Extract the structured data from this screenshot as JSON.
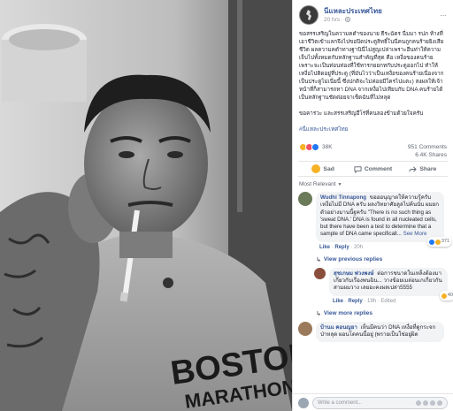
{
  "post": {
    "page_name": "นี่แหละประเทศไทย",
    "time": "20 hrs ·",
    "body_1": "ขอสรรเสริญในความคดำของนาย ธีระฉัตร นี่มมา รปภ ห้างที่เอาชีวิตเข้าแลกจึงไปขอปิดประตูสิทธิ์ในนี่คนถูกคนร้ายยิงเสียชีวิต ผลความคดำทางฐานินี่ไม่สูญเปล่าเพราะฮีนท่าให้ความเจ็บไปทั้งหมดกับหลักฐานสำคัญที่สุด คือ เหงื่อของคนร้าย เพราะจะเป็นท่อนท่องที่ใช้ทารกยยกทกับประตูออกไป ทำให้เหงื่อไปติดอยู่ที่ประตู (ที่มันไวว่าเป็นเหงื่อของคนร้ายเนื่องจากเป็นประตูไม่เนี่ยนี้ ซึ่งปกติจะไม่ค่อยมีใครไปแตะ) สงผลให้เจ้าหน้าที่ก็สามารถหา DNA จากเหงื่อไปเทียบกับ DNA คนร้ายได้ เป็นหลักฐานชัดต่อยจาเช็ดฉันที่ไม่หลุด",
    "body_2": "ขอคารวะ และสรรเสริญฮีโร่ที่คนลองข้ามด้วยใจครับ",
    "hashtag": "#นี่แหละประเทศไทย",
    "reaction_count": "38K",
    "comment_count": "951 Comments",
    "share_count": "6.4K Shares",
    "action_react": "Sad",
    "action_comment": "Comment",
    "action_share": "Share",
    "sort_label": "Most Relevant"
  },
  "comments": [
    {
      "author": "Wudhi Tinnapong",
      "text": "ขอออนุญาตให้ความรู้ครับ เหงื่อไม่มี DNA ครับ ผลงวิทยาศัยลูลไปค้นนับ ผมยกตัวอย่างมานนี้ฐครับ \"There is no such thing as 'sweat DNA.' DNA is found in all nucleated cells, but there have been a test to determine that a sample of DNA came specificall...",
      "see_more": "See More",
      "reaction_badge": "371",
      "like": "Like",
      "reply": "Reply",
      "time": "20h",
      "avatar_color": "#6b7a58"
    }
  ],
  "view_previous": "View previous replies",
  "replies": [
    {
      "author": "สุชเกษม พ่วงพงษ์",
      "text": "ต่อการชนาดในเหล็งต้องมาเกี่ยวกับเรื่องพนฉิน... วางข้อยเมล่อนเกเกี่ยวกัน สามผมวาง เลยอะคงผลเปล่า5555",
      "reaction_badge": "40",
      "like": "Like",
      "reply": "Reply",
      "time": "19h",
      "edited": "Edited",
      "avatar_color": "#8a4f3c"
    }
  ],
  "view_more": "View more replies",
  "last_comment": {
    "author": "บ้านแ คอนญยา",
    "text": "เห็นมีคนว่า DNA เหงื่อที่ดูกระจกป่าหลุด ผอนโดคนนี้อยู่ (พรายเป็นใช่อยู่ผิด",
    "avatar_color": "#9a7a5a"
  },
  "write_placeholder": "Write a comment...",
  "photo": {
    "shirt_text_1": "BOSTON",
    "shirt_text_2": "MARATHON"
  },
  "colors": {
    "link": "#385898",
    "haha": "#f7b125",
    "love": "#f25268",
    "like": "#2078f4"
  }
}
